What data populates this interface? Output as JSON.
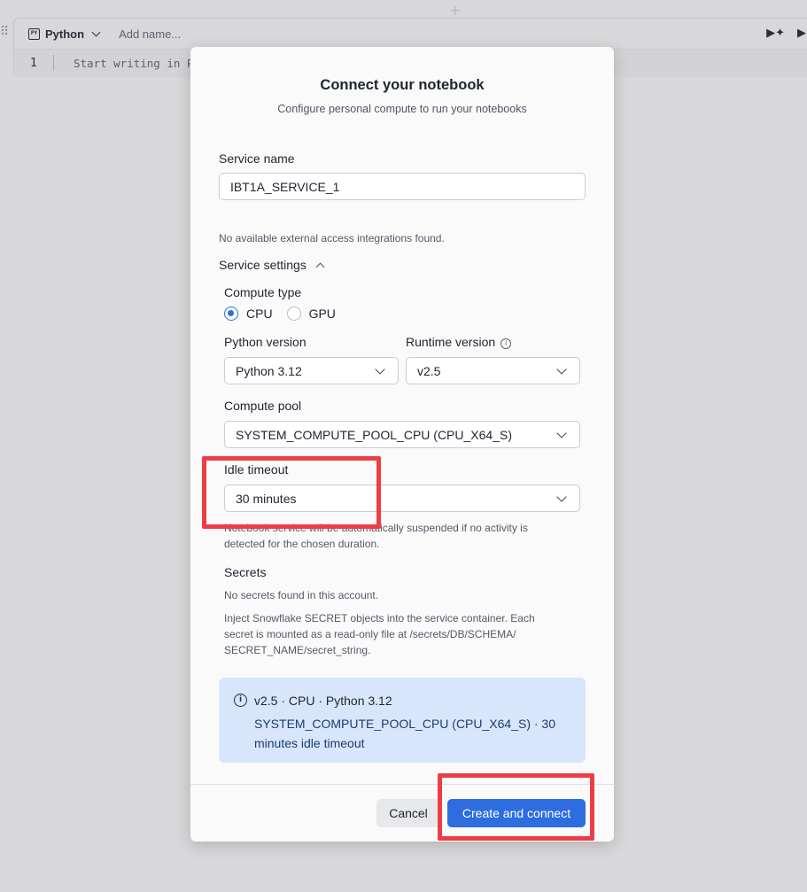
{
  "background_cell": {
    "language": "Python",
    "language_icon_text": "PY",
    "name_placeholder": "Add name...",
    "line_number": "1",
    "code_placeholder": "Start writing in P"
  },
  "modal": {
    "title": "Connect your notebook",
    "subtitle": "Configure personal compute to run your notebooks",
    "service_name": {
      "label": "Service name",
      "value": "IBT1A_SERVICE_1"
    },
    "integrations_note": "No available external access integrations found.",
    "service_settings_label": "Service settings",
    "compute_type": {
      "label": "Compute type",
      "options": [
        "CPU",
        "GPU"
      ],
      "selected": "CPU"
    },
    "python_version": {
      "label": "Python version",
      "value": "Python 3.12"
    },
    "runtime_version": {
      "label": "Runtime version",
      "value": "v2.5"
    },
    "compute_pool": {
      "label": "Compute pool",
      "value": "SYSTEM_COMPUTE_POOL_CPU (CPU_X64_S)"
    },
    "idle_timeout": {
      "label": "Idle timeout",
      "value": "30 minutes",
      "help_line1": "Notebook service will be automatically suspended if no activity is",
      "help_line2": "detected for the chosen duration."
    },
    "secrets": {
      "label": "Secrets",
      "none_found": "No secrets found in this account.",
      "help_line1": "Inject Snowflake SECRET objects into the service container. Each",
      "help_line2": "secret is mounted as a read-only file at /secrets/DB/SCHEMA/",
      "help_line3": "SECRET_NAME/secret_string."
    },
    "summary": {
      "line1": "v2.5 · CPU · Python 3.12",
      "line2": "SYSTEM_COMPUTE_POOL_CPU (CPU_X64_S) · 30 minutes idle timeout"
    },
    "buttons": {
      "cancel": "Cancel",
      "create": "Create and connect"
    }
  },
  "colors": {
    "accent": "#2d6de0",
    "summary_bg": "#d8e6fb",
    "highlight": "#ee3e45"
  }
}
